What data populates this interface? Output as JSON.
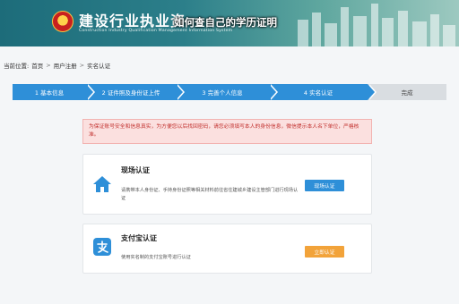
{
  "header": {
    "site_title": "建设行业执业资",
    "site_subtitle": "Construction Industry Qualification Management Information System",
    "overlay_caption": "如何查自己的学历证明"
  },
  "breadcrumb": {
    "prefix": "当前位置:",
    "items": [
      "首页",
      "用户注册",
      "实名认证"
    ],
    "separator": ">"
  },
  "steps": [
    {
      "label": "1 基本信息"
    },
    {
      "label": "2 证件照及身份证上传"
    },
    {
      "label": "3 完善个人信息"
    },
    {
      "label": "4 实名认证"
    },
    {
      "label": "完成"
    }
  ],
  "notice": {
    "text": "为保证账号安全和信息真实，为方便您以后找回密码，请您必须填写本人的身份信息，微信提示本人名下单位，严格核准。"
  },
  "cards": [
    {
      "title": "现场认证",
      "description": "请携带本人身份证、手持身份证照等相关材料前往省住建城乡建设主管部门进行现场认证",
      "button": "现场认证",
      "icon": "house-icon"
    },
    {
      "title": "支付宝认证",
      "description": "使用实名制的支付宝账号进行认证",
      "button": "立即认证",
      "icon": "alipay-icon"
    }
  ],
  "colors": {
    "accent_blue": "#2e8fd8",
    "accent_orange": "#f2a33a",
    "notice_red": "#c2312e",
    "header_teal": "#2c7f8a"
  }
}
